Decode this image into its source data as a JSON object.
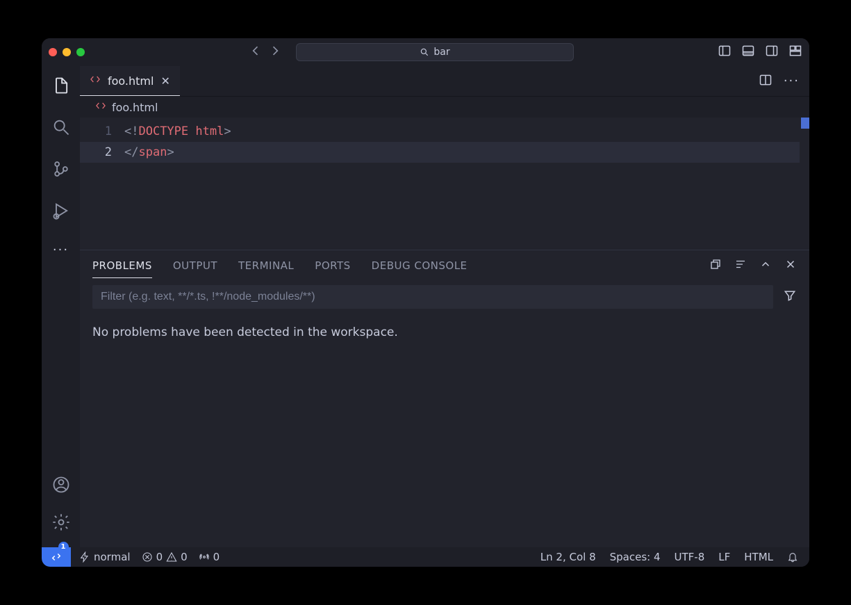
{
  "titlebar": {
    "search_text": "bar"
  },
  "tab": {
    "filename": "foo.html"
  },
  "breadcrumb": {
    "filename": "foo.html"
  },
  "editor": {
    "lines": [
      {
        "num": "1",
        "tokens": [
          [
            "cb",
            "<!"
          ],
          [
            "kw",
            "DOCTYPE "
          ],
          [
            "attr",
            "html"
          ],
          [
            "cb",
            ">"
          ]
        ]
      },
      {
        "num": "2",
        "tokens": [
          [
            "cb",
            "</"
          ],
          [
            "tagn",
            "span"
          ],
          [
            "cb",
            ">"
          ]
        ]
      }
    ],
    "active_line_index": 1
  },
  "panel": {
    "tabs": [
      "PROBLEMS",
      "OUTPUT",
      "TERMINAL",
      "PORTS",
      "DEBUG CONSOLE"
    ],
    "active_tab": 0,
    "filter_placeholder": "Filter (e.g. text, **/*.ts, !**/node_modules/**)",
    "body_text": "No problems have been detected in the workspace."
  },
  "status": {
    "mode": "normal",
    "errors": "0",
    "warnings": "0",
    "ports": "0",
    "cursor": "Ln 2, Col 8",
    "indent": "Spaces: 4",
    "encoding": "UTF-8",
    "eol": "LF",
    "lang": "HTML"
  },
  "settings_badge": "1"
}
